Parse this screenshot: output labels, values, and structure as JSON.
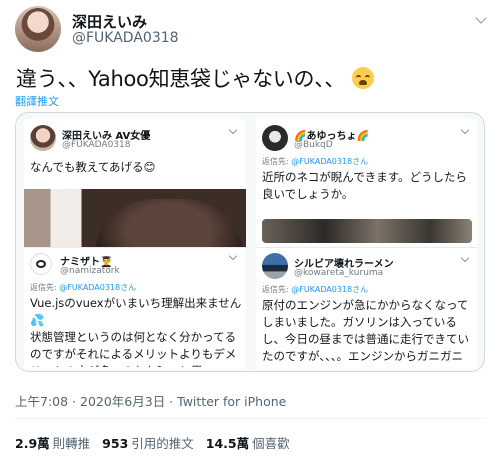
{
  "author": {
    "name": "深田えいみ",
    "handle": "@FUKADA0318"
  },
  "tweet": {
    "text": "違う、、Yahoo知恵袋じゃないの、、",
    "translate_label": "翻譯推文"
  },
  "cards": {
    "left_top": {
      "name": "深田えいみ AV女優",
      "handle": "@FUKADA0318",
      "text": "なんでも教えてあげる😊"
    },
    "left_bottom": {
      "name": "ナミザト👨‍🎓",
      "handle": "@namizatork",
      "reply_prefix": "返信先: ",
      "reply_to": "@FUKADA0318さん",
      "text": "Vue.jsのvuexがいまいち理解出来ません💦\n状態管理というのは何となく分かってるのですがそれによるメリットよりもデメリットの方が多いのかな？っと思"
    },
    "right_top": {
      "name": "🌈あゆっちょ🌈",
      "handle": "@BukqD",
      "reply_prefix": "返信先: ",
      "reply_to": "@FUKADA0318さん",
      "text": "近所のネコが睨んできます。どうしたら良いでしょうか。"
    },
    "right_bottom": {
      "name": "シルビア壊れラーメン",
      "handle": "@kowareta_kuruma",
      "reply_prefix": "返信先: ",
      "reply_to": "@FUKADA0318さん",
      "text": "原付のエンジンが急にかからなくなってしまいました。ガソリンは入っているし、今日の昼までは普通に走行できていたのですが、、、。エンジンからガニガニと変な音がします。原因を"
    }
  },
  "meta": {
    "timestamp": "上午7:08 · 2020年6月3日 · Twitter for iPhone"
  },
  "stats": {
    "retweets_count": "2.9萬",
    "retweets_label": "則轉推",
    "quotes_count": "953",
    "quotes_label": "引用的推文",
    "likes_count": "14.5萬",
    "likes_label": "個喜歡"
  },
  "colors": {
    "link": "#1d9bf0",
    "secondary": "#536471"
  },
  "icons": [
    "more-chevron-icon",
    "loudly-crying-face-emoji"
  ]
}
